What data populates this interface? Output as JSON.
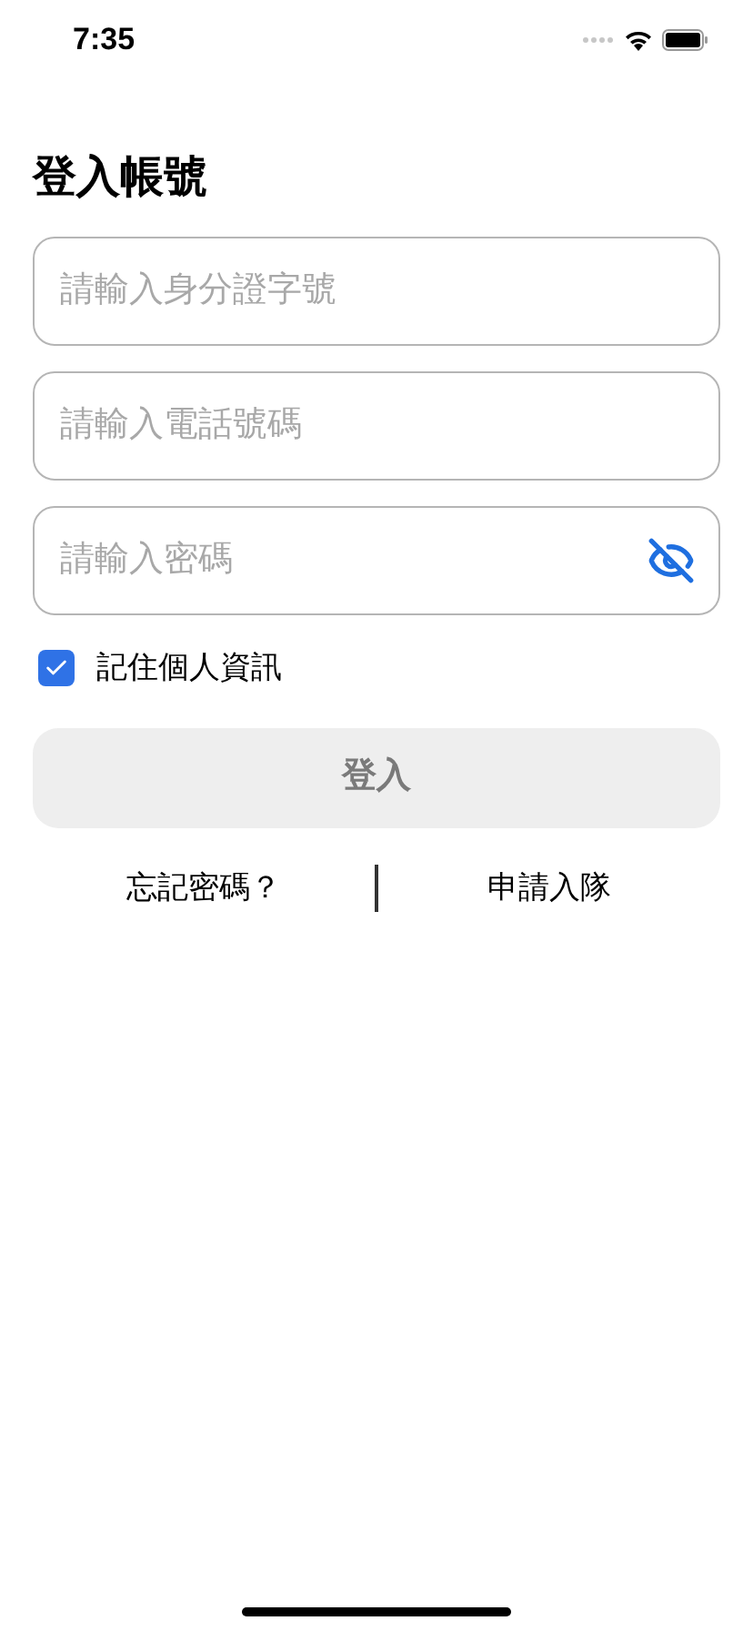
{
  "status_bar": {
    "time": "7:35"
  },
  "title": "登入帳號",
  "fields": [
    {
      "kind": "text",
      "placeholder": "請輸入身分證字號"
    },
    {
      "kind": "text",
      "placeholder": "請輸入電話號碼"
    },
    {
      "kind": "password",
      "placeholder": "請輸入密碼"
    }
  ],
  "remember": {
    "label": "記住個人資訊",
    "checked": true
  },
  "login_button": {
    "label": "登入",
    "disabled": true
  },
  "links": [
    "忘記密碼？",
    "申請入隊"
  ]
}
